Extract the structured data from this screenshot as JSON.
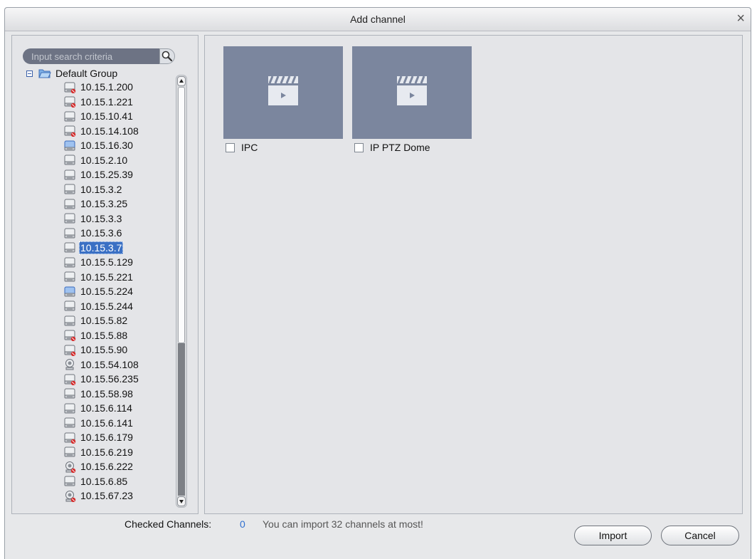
{
  "dialog": {
    "title": "Add channel",
    "close_glyph": "×"
  },
  "search": {
    "placeholder": "Input search criteria",
    "value": "",
    "icon": "search-icon"
  },
  "tree": {
    "group_label": "Default Group",
    "group_icon": "folder-open-icon",
    "devices": [
      {
        "label": "10.15.1.200",
        "icon": "dvr-offline-icon"
      },
      {
        "label": "10.15.1.221",
        "icon": "dvr-offline-icon"
      },
      {
        "label": "10.15.10.41",
        "icon": "dvr-icon"
      },
      {
        "label": "10.15.14.108",
        "icon": "dvr-offline-icon"
      },
      {
        "label": "10.15.16.30",
        "icon": "dvr-blue-icon"
      },
      {
        "label": "10.15.2.10",
        "icon": "dvr-icon"
      },
      {
        "label": "10.15.25.39",
        "icon": "dvr-icon"
      },
      {
        "label": "10.15.3.2",
        "icon": "dvr-icon"
      },
      {
        "label": "10.15.3.25",
        "icon": "dvr-icon"
      },
      {
        "label": "10.15.3.3",
        "icon": "dvr-icon"
      },
      {
        "label": "10.15.3.6",
        "icon": "dvr-icon"
      },
      {
        "label": "10.15.3.7",
        "icon": "dvr-icon",
        "selected": true
      },
      {
        "label": "10.15.5.129",
        "icon": "dvr-icon"
      },
      {
        "label": "10.15.5.221",
        "icon": "dvr-icon"
      },
      {
        "label": "10.15.5.224",
        "icon": "dvr-blue-icon"
      },
      {
        "label": "10.15.5.244",
        "icon": "dvr-icon"
      },
      {
        "label": "10.15.5.82",
        "icon": "dvr-icon"
      },
      {
        "label": "10.15.5.88",
        "icon": "dvr-offline-icon"
      },
      {
        "label": "10.15.5.90",
        "icon": "dvr-offline-icon"
      },
      {
        "label": "10.15.54.108",
        "icon": "camera-icon"
      },
      {
        "label": "10.15.56.235",
        "icon": "dvr-offline-icon"
      },
      {
        "label": "10.15.58.98",
        "icon": "dvr-icon"
      },
      {
        "label": "10.15.6.114",
        "icon": "dvr-icon"
      },
      {
        "label": "10.15.6.141",
        "icon": "dvr-icon"
      },
      {
        "label": "10.15.6.179",
        "icon": "dvr-offline-icon"
      },
      {
        "label": "10.15.6.219",
        "icon": "dvr-icon"
      },
      {
        "label": "10.15.6.222",
        "icon": "camera-offline-icon"
      },
      {
        "label": "10.15.6.85",
        "icon": "dvr-icon"
      },
      {
        "label": "10.15.67.23",
        "icon": "camera-offline-icon"
      }
    ]
  },
  "channels": [
    {
      "label": "IPC",
      "checked": false,
      "icon": "video-clapper-icon"
    },
    {
      "label": "IP PTZ Dome",
      "checked": false,
      "icon": "video-clapper-icon"
    }
  ],
  "footer": {
    "checked_label": "Checked Channels:",
    "checked_count": "0",
    "hint": "You can import 32 channels at most!",
    "import_label": "Import",
    "cancel_label": "Cancel"
  },
  "colors": {
    "accent_blue": "#3a70c4",
    "count_blue": "#2f6fd0",
    "thumbnail_bg": "#7b869e",
    "search_bg": "#6d7384",
    "offline_red": "#d42a2a"
  }
}
